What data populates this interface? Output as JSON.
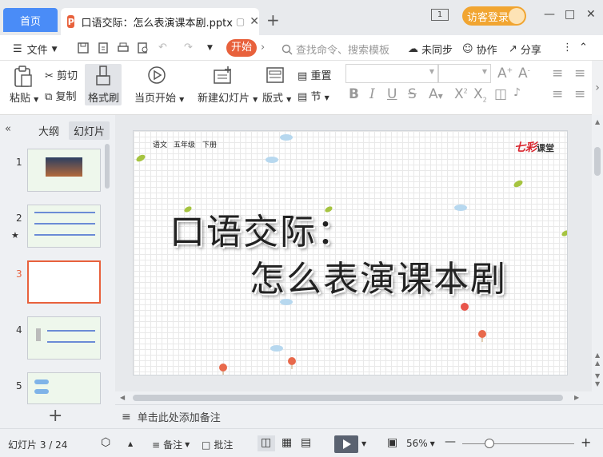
{
  "titlebar": {
    "home_tab": "首页",
    "doc_badge": "P",
    "doc_title": "口语交际：怎么表演课本剧.pptx",
    "window_number": "1",
    "guest_login": "访客登录"
  },
  "menubar": {
    "file_menu": "文件",
    "start_tab": "开始",
    "search_placeholder": "查找命令、搜索模板",
    "unsynced": "未同步",
    "collaborate": "协作",
    "share": "分享"
  },
  "ribbon": {
    "paste": "粘贴",
    "cut": "剪切",
    "copy": "复制",
    "format_painter": "格式刷",
    "from_current": "当页开始",
    "new_slide": "新建幻灯片",
    "layout": "版式",
    "reset": "重置",
    "section": "节"
  },
  "left_panel": {
    "outline_tab": "大纲",
    "slides_tab": "幻灯片",
    "slides": [
      {
        "num": "1"
      },
      {
        "num": "2"
      },
      {
        "num": "3"
      },
      {
        "num": "4"
      },
      {
        "num": "5"
      }
    ],
    "active_index": 3
  },
  "slide": {
    "crumb_subject": "语文",
    "crumb_grade": "五年级",
    "crumb_volume": "下册",
    "title_line1": "口语交际：",
    "title_line2": "怎么表演课本剧",
    "logo_main": "七彩",
    "logo_sub": "课堂"
  },
  "notes": {
    "placeholder": "单击此处添加备注"
  },
  "statusbar": {
    "slide_counter": "幻灯片 3 / 24",
    "notes_btn": "备注",
    "comments_btn": "批注",
    "zoom": "56%"
  },
  "colors": {
    "accent_orange": "#e8613c",
    "home_blue": "#4a8cf7",
    "guest_gold": "#f1a531"
  }
}
